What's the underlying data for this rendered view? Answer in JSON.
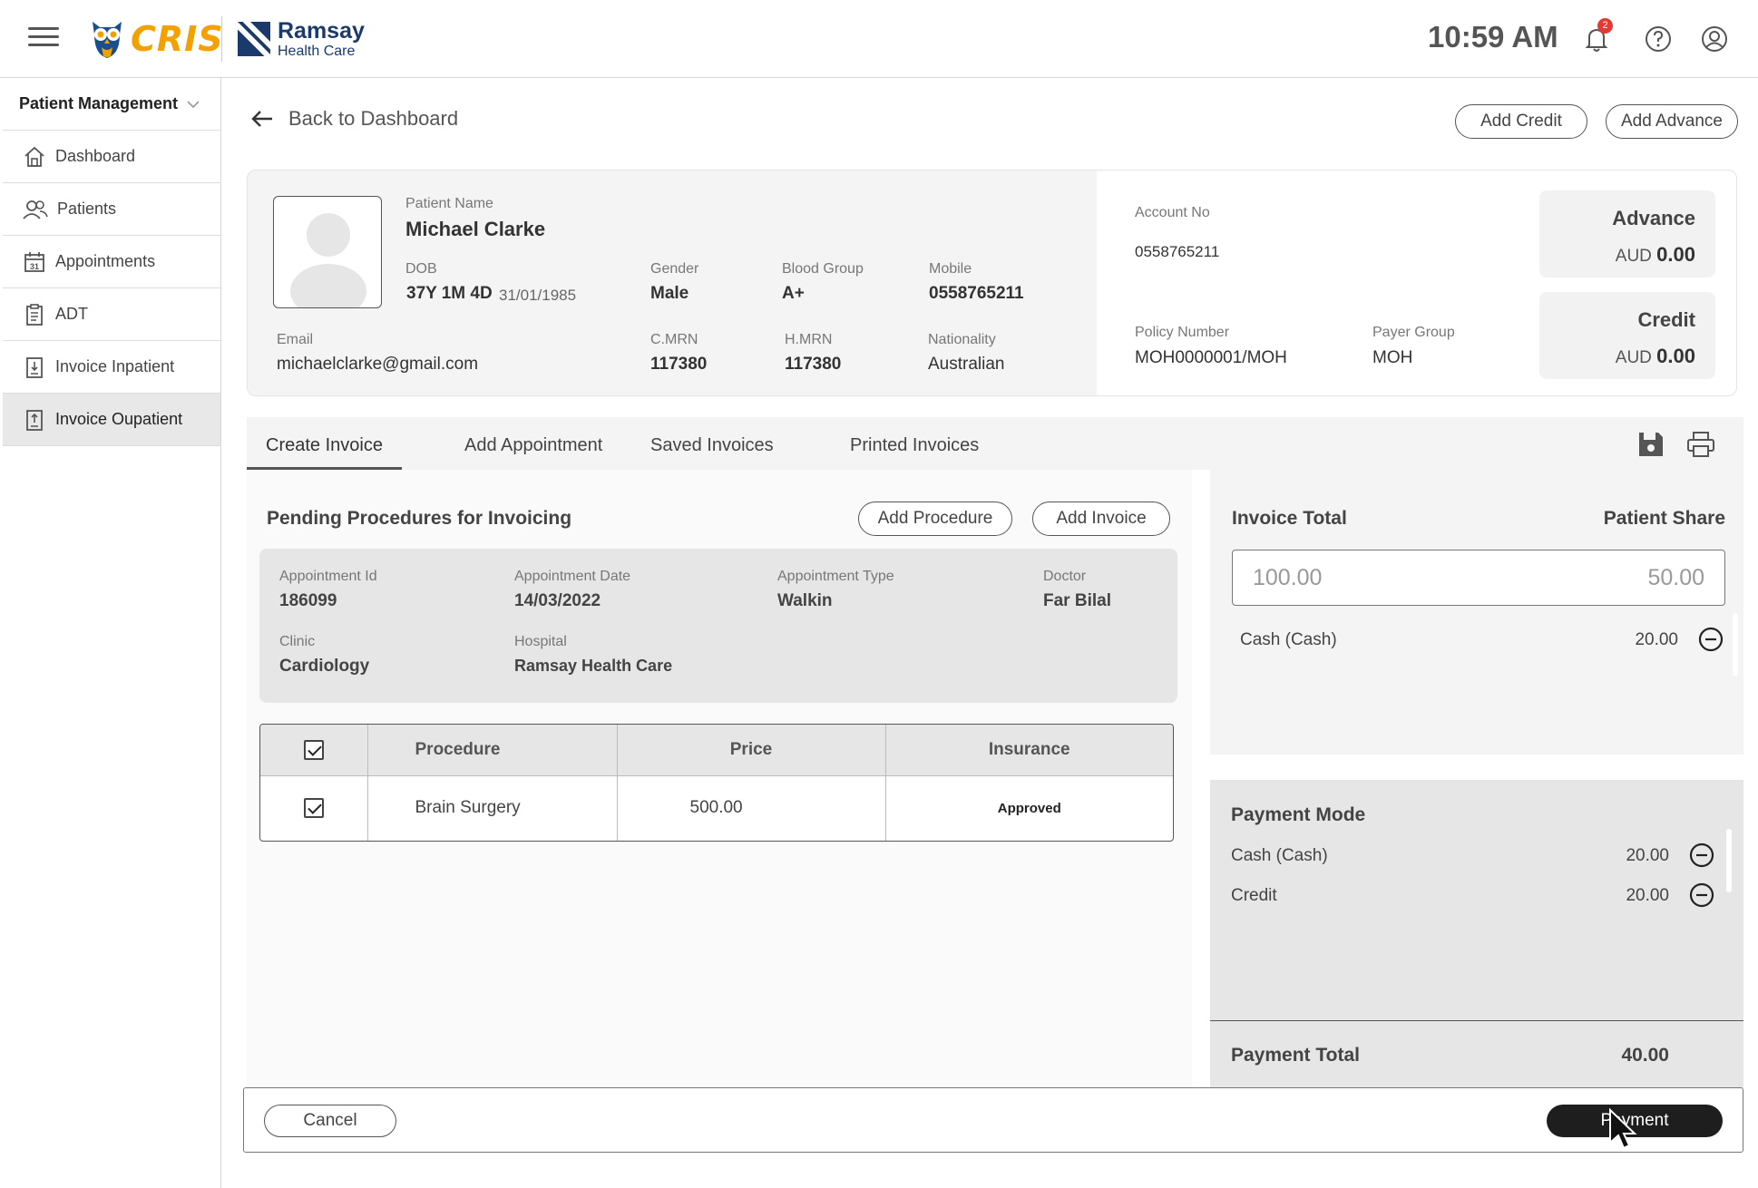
{
  "header": {
    "brand": "CRIS",
    "partner_line1": "Ramsay",
    "partner_line2": "Health Care",
    "time": "10:59 AM",
    "notification_count": "2"
  },
  "sidebar": {
    "section": "Patient Management",
    "items": [
      {
        "label": "Dashboard",
        "icon": "home-icon"
      },
      {
        "label": "Patients",
        "icon": "users-icon"
      },
      {
        "label": "Appointments",
        "icon": "calendar-icon",
        "calendar_day": "31"
      },
      {
        "label": "ADT",
        "icon": "clipboard-icon"
      },
      {
        "label": "Invoice Inpatient",
        "icon": "invoice-icon"
      },
      {
        "label": "Invoice Oupatient",
        "icon": "invoice-icon",
        "active": true
      }
    ]
  },
  "nav": {
    "back_label": "Back to Dashboard",
    "add_credit": "Add Credit",
    "add_advance": "Add Advance"
  },
  "patient": {
    "name_label": "Patient Name",
    "name": "Michael Clarke",
    "dob_label": "DOB",
    "age": "37Y 1M 4D",
    "dob": "31/01/1985",
    "gender_label": "Gender",
    "gender": "Male",
    "blood_group_label": "Blood Group",
    "blood_group": "A+",
    "mobile_label": "Mobile",
    "mobile": "0558765211",
    "email_label": "Email",
    "email": "michaelclarke@gmail.com",
    "cmrn_label": "C.MRN",
    "cmrn": "117380",
    "hmrn_label": "H.MRN",
    "hmrn": "117380",
    "nationality_label": "Nationality",
    "nationality": "Australian"
  },
  "account": {
    "account_no_label": "Account No",
    "account_no": "0558765211",
    "policy_label": "Policy Number",
    "policy": "MOH0000001/MOH",
    "payer_label": "Payer Group",
    "payer": "MOH",
    "advance_title": "Advance",
    "advance_currency": "AUD",
    "advance_amount": "0.00",
    "credit_title": "Credit",
    "credit_currency": "AUD",
    "credit_amount": "0.00"
  },
  "tabs": [
    {
      "label": "Create Invoice",
      "active": true
    },
    {
      "label": "Add Appointment"
    },
    {
      "label": "Saved Invoices"
    },
    {
      "label": "Printed Invoices"
    }
  ],
  "pending": {
    "title": "Pending Procedures for Invoicing",
    "add_procedure": "Add Procedure",
    "add_invoice": "Add Invoice",
    "appointment": {
      "id_label": "Appointment Id",
      "id": "186099",
      "date_label": "Appointment Date",
      "date": "14/03/2022",
      "type_label": "Appointment Type",
      "type": "Walkin",
      "doctor_label": "Doctor",
      "doctor": "Far Bilal",
      "clinic_label": "Clinic",
      "clinic": "Cardiology",
      "hospital_label": "Hospital",
      "hospital": "Ramsay Health Care"
    },
    "table": {
      "headers": [
        "Procedure",
        "Price",
        "Insurance"
      ],
      "rows": [
        {
          "procedure": "Brain Surgery",
          "price": "500.00",
          "insurance": "Approved"
        }
      ]
    }
  },
  "invoice": {
    "total_label": "Invoice Total",
    "share_label": "Patient Share",
    "total": "100.00",
    "share": "50.00",
    "lines": [
      {
        "label": "Cash (Cash)",
        "amount": "20.00"
      }
    ]
  },
  "payment": {
    "mode_title": "Payment Mode",
    "modes": [
      {
        "label": "Cash (Cash)",
        "amount": "20.00"
      },
      {
        "label": "Credit",
        "amount": "20.00"
      }
    ],
    "total_label": "Payment Total",
    "total": "40.00"
  },
  "footer": {
    "cancel": "Cancel",
    "payment": "Payment"
  }
}
